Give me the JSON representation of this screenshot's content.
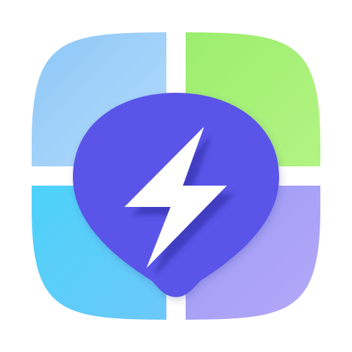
{
  "icon": {
    "name": "lightning-pin-app-icon",
    "tiles": [
      {
        "position": "top-left",
        "color_start": "#8cc6f7",
        "color_end": "#b5dcfb"
      },
      {
        "position": "top-right",
        "color_start": "#9ced6e",
        "color_end": "#b3f483"
      },
      {
        "position": "bottom-left",
        "color_start": "#4cd2fa",
        "color_end": "#6dc8f8"
      },
      {
        "position": "bottom-right",
        "color_start": "#9c9cf5",
        "color_end": "#b6a8f8"
      }
    ],
    "divider_color": "#ffffff",
    "pin_color": "#5a55e8",
    "bolt_color": "#ffffff",
    "bolt_shadow_color": "#2d2aa0"
  }
}
